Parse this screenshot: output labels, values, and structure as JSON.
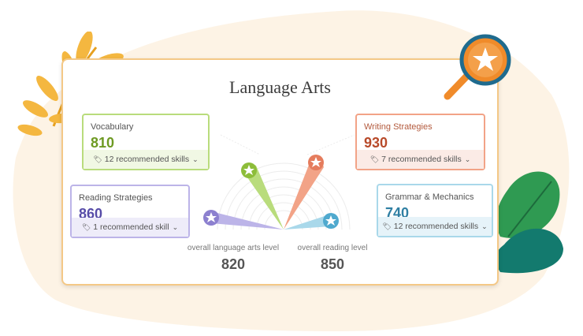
{
  "title": "Language Arts",
  "skills": {
    "vocabulary": {
      "name": "Vocabulary",
      "score": "810",
      "rec": "12 recommended skills",
      "color": "#8dbd3a",
      "recbg": "#f1f8e4"
    },
    "writing": {
      "name": "Writing Strategies",
      "score": "930",
      "rec": "7 recommended skills",
      "color": "#e57c5d",
      "recbg": "#fbebe6"
    },
    "reading": {
      "name": "Reading Strategies",
      "score": "860",
      "rec": "1 recommended skill",
      "color": "#8c80cf",
      "recbg": "#eeecf9"
    },
    "grammar": {
      "name": "Grammar & Mechanics",
      "score": "740",
      "rec": "12 recommended skills",
      "color": "#4fa9ce",
      "recbg": "#e6f3f9"
    }
  },
  "levels": {
    "overall_label": "overall language arts level",
    "overall_value": "820",
    "reading_label": "overall reading level",
    "reading_value": "850"
  },
  "icons": [
    "magnifier-icon",
    "star-icon",
    "leaf-icon",
    "chevron-down-icon",
    "tag-icon"
  ]
}
